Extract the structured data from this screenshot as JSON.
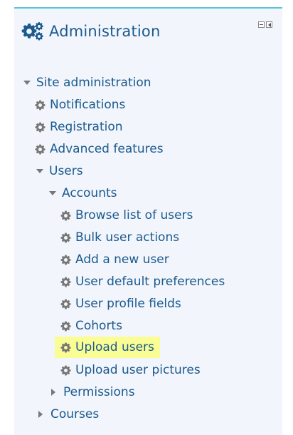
{
  "block": {
    "title": "Administration",
    "icon": "gears-icon",
    "controls": [
      "minimize-icon",
      "dock-icon"
    ]
  },
  "tree": {
    "site_admin": "Site administration",
    "notifications": "Notifications",
    "registration": "Registration",
    "advanced_features": "Advanced features",
    "users": "Users",
    "accounts": "Accounts",
    "browse_users": "Browse list of users",
    "bulk_actions": "Bulk user actions",
    "add_user": "Add a new user",
    "user_default_prefs": "User default preferences",
    "user_profile_fields": "User profile fields",
    "cohorts": "Cohorts",
    "upload_users": "Upload users",
    "upload_pictures": "Upload user pictures",
    "permissions": "Permissions",
    "courses": "Courses"
  },
  "colors": {
    "link": "#1a5a8f",
    "accent_border": "#5bc4dd",
    "block_bg": "#f2f5fb",
    "highlight": "#fafd94",
    "icon_gray": "#777777"
  }
}
